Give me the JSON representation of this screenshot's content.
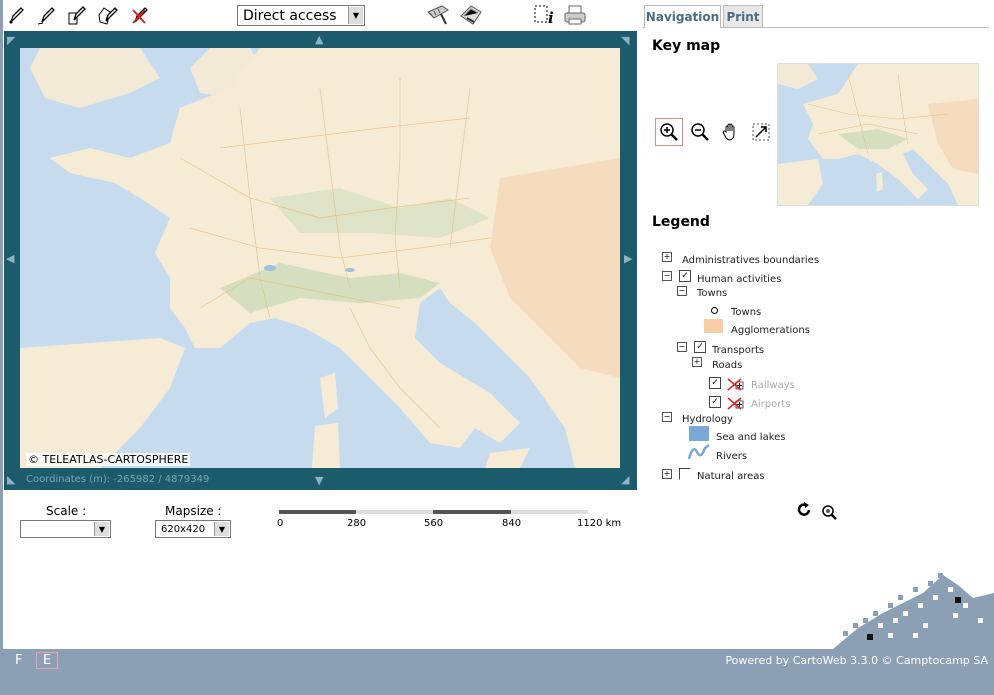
{
  "toolbar": {
    "direct_access_value": "Direct access",
    "icons": [
      "pencil-point-icon",
      "pencil-line-icon",
      "pencil-rect-icon",
      "pencil-polygon-icon",
      "pencil-delete-icon",
      "measure-distance-icon",
      "measure-area-icon",
      "query-info-icon",
      "print-icon"
    ]
  },
  "map": {
    "copyright": "© TELEATLAS-CARTOSPHERE",
    "coordinates": "Coordinates (m): -265982 / 4879349"
  },
  "scale": {
    "label": "Scale :",
    "value": ""
  },
  "mapsize": {
    "label": "Mapsize :",
    "value": "620x420"
  },
  "scalebar": {
    "ticks": [
      "0",
      "280",
      "560",
      "840",
      "1120 km"
    ]
  },
  "tabs": {
    "navigation": "Navigation",
    "print": "Print",
    "active": "Navigation"
  },
  "keymap": {
    "title": "Key map"
  },
  "nav_tools": [
    "zoom-in-icon",
    "zoom-out-icon",
    "pan-hand-icon",
    "full-extent-icon"
  ],
  "legend": {
    "title": "Legend",
    "admin": "Administratives boundaries",
    "human": "Human activities",
    "towns_group": "Towns",
    "towns": "Towns",
    "agglomerations": "Agglomerations",
    "transports": "Transports",
    "roads": "Roads",
    "railways": "Railways",
    "airports": "Airports",
    "hydrology": "Hydrology",
    "sea": "Sea and lakes",
    "rivers": "Rivers",
    "natural": "Natural areas"
  },
  "footer": {
    "lang_f": "F",
    "lang_e": "E",
    "powered": "Powered by CartoWeb 3.3.0 © Camptocamp SA"
  },
  "colors": {
    "frame": "#1b5b6b",
    "footer": "#8b9fb5",
    "sea": "#c6dcee",
    "land": "#f6ecd6"
  }
}
